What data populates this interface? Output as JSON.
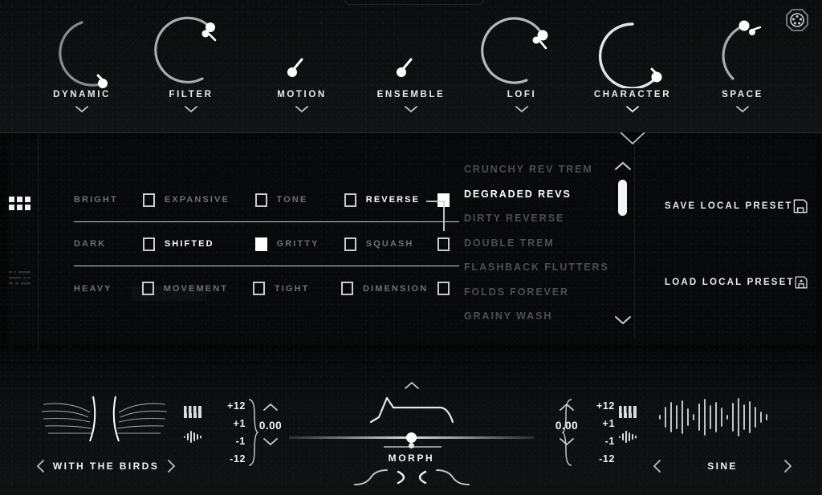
{
  "app": {
    "accent": "#ffffff",
    "dim_text": "#6c6f70",
    "panel_bg": "#070809",
    "background": "#050607"
  },
  "top_bar": {
    "midi_icon": "midi-din-icon",
    "knobs": [
      {
        "name": "DYNAMIC",
        "value_deg": 318,
        "active": false
      },
      {
        "name": "FILTER",
        "value_deg": 272,
        "active": false
      },
      {
        "name": "MOTION",
        "value_deg": 8,
        "active": false
      },
      {
        "name": "ENSEMBLE",
        "value_deg": 8,
        "active": false
      },
      {
        "name": "LOFI",
        "value_deg": 256,
        "active": false
      },
      {
        "name": "CHARACTER",
        "value_deg": 320,
        "active": true
      },
      {
        "name": "SPACE",
        "value_deg": 120,
        "active": false
      }
    ]
  },
  "rail": {
    "items": [
      {
        "icon": "grid-icon",
        "label": "Grid view",
        "active": true
      },
      {
        "icon": "list-icon",
        "label": "List view",
        "active": false
      }
    ]
  },
  "effect_grid": {
    "rows": [
      {
        "cells": [
          {
            "label": "BRIGHT",
            "checked": false
          },
          {
            "label": "EXPANSIVE",
            "checked": false
          },
          {
            "label": "TONE",
            "checked": false
          },
          {
            "label": "REVERSE",
            "checked": true
          }
        ]
      },
      {
        "cells": [
          {
            "label": "DARK",
            "checked": false
          },
          {
            "label": "SHIFTED",
            "checked": true
          },
          {
            "label": "GRITTY",
            "checked": false
          },
          {
            "label": "SQUASH",
            "checked": false
          }
        ]
      },
      {
        "cells": [
          {
            "label": "HEAVY",
            "checked": false
          },
          {
            "label": "MOVEMENT",
            "checked": false
          },
          {
            "label": "TIGHT",
            "checked": false
          },
          {
            "label": "DIMENSION",
            "checked": false
          }
        ]
      }
    ]
  },
  "preset_list": {
    "selected": "DEGRADED REVS",
    "items": [
      {
        "name": "CRUNCHY REV TREM",
        "selected": false
      },
      {
        "name": "DEGRADED REVS",
        "selected": true
      },
      {
        "name": "DIRTY REVERSE",
        "selected": false
      },
      {
        "name": "DOUBLE TREM",
        "selected": false
      },
      {
        "name": "FLASHBACK FLUTTERS",
        "selected": false
      },
      {
        "name": "FOLDS FOREVER",
        "selected": false
      },
      {
        "name": "GRAINY WASH",
        "selected": false
      }
    ],
    "scroll_up_icon": "chevron-up-icon",
    "scroll_down_icon": "chevron-down-icon"
  },
  "preset_actions": {
    "save_label": "SAVE LOCAL PRESET",
    "save_icon": "floppy-save-icon",
    "load_label": "LOAD LOCAL PRESET",
    "load_icon": "floppy-load-icon"
  },
  "sources": {
    "left": {
      "name": "WITH THE BIRDS",
      "prev_icon": "chevron-left-icon",
      "next_icon": "chevron-right-icon",
      "keys_icon": "piano-keys-icon",
      "wave_icon": "waveform-icon",
      "pitch_scale": [
        "+12",
        "+1",
        "-1",
        "-12"
      ],
      "tune_value": "0.00",
      "up_icon": "chevron-up-icon",
      "down_icon": "chevron-down-icon"
    },
    "right": {
      "name": "SINE",
      "prev_icon": "chevron-left-icon",
      "next_icon": "chevron-right-icon",
      "keys_icon": "piano-keys-icon",
      "wave_icon": "waveform-icon",
      "pitch_scale": [
        "+12",
        "+1",
        "-1",
        "-12"
      ],
      "tune_value": "0.00",
      "up_icon": "chevron-up-icon",
      "down_icon": "chevron-down-icon"
    }
  },
  "morph": {
    "label": "MORPH",
    "value_pct": 50,
    "up_icon": "chevron-up-icon",
    "envelope_icon": "envelope-curve-icon",
    "crossfade_icon": "crossfade-x-icon"
  }
}
